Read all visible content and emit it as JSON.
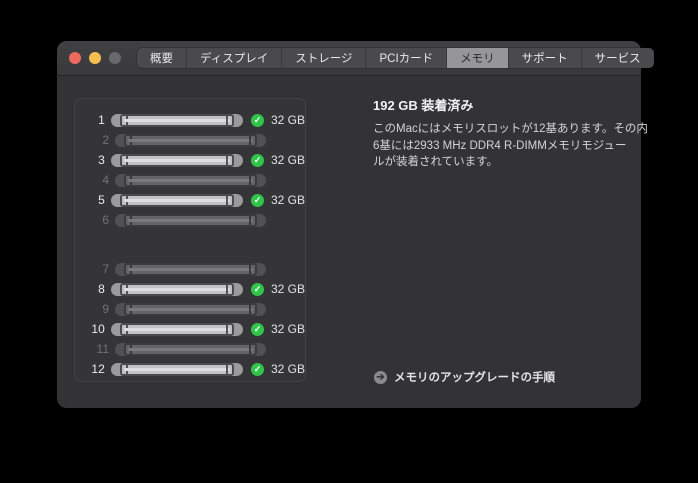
{
  "window": {
    "traffic_lights": {
      "close": "close-button",
      "minimize": "minimize-button",
      "zoom": "zoom-button-disabled"
    },
    "tabs": [
      {
        "label": "概要",
        "selected": false
      },
      {
        "label": "ディスプレイ",
        "selected": false
      },
      {
        "label": "ストレージ",
        "selected": false
      },
      {
        "label": "PCIカード",
        "selected": false
      },
      {
        "label": "メモリ",
        "selected": true
      },
      {
        "label": "サポート",
        "selected": false
      },
      {
        "label": "サービス",
        "selected": false
      }
    ]
  },
  "memory": {
    "summary_title": "192 GB 装着済み",
    "summary_body": "このMacにはメモリスロットが12基あります。その内\n6基には2933 MHz DDR4 R-DIMMメモリモジュー\nルが装着されています。",
    "upgrade_link_label": "メモリのアップグレードの手順",
    "slots": [
      {
        "num": "1",
        "populated": true,
        "size": "32 GB"
      },
      {
        "num": "2",
        "populated": false,
        "size": ""
      },
      {
        "num": "3",
        "populated": true,
        "size": "32 GB"
      },
      {
        "num": "4",
        "populated": false,
        "size": ""
      },
      {
        "num": "5",
        "populated": true,
        "size": "32 GB"
      },
      {
        "num": "6",
        "populated": false,
        "size": ""
      },
      {
        "num": "7",
        "populated": false,
        "size": ""
      },
      {
        "num": "8",
        "populated": true,
        "size": "32 GB"
      },
      {
        "num": "9",
        "populated": false,
        "size": ""
      },
      {
        "num": "10",
        "populated": true,
        "size": "32 GB"
      },
      {
        "num": "11",
        "populated": false,
        "size": ""
      },
      {
        "num": "12",
        "populated": true,
        "size": "32 GB"
      }
    ]
  },
  "icons": {
    "check_icon_glyph": "✓",
    "arrow_icon_glyph": "➔"
  },
  "colors": {
    "status_green": "#30c54a",
    "selected_tab_bg": "#969698",
    "traffic_red": "#ec6a5e",
    "traffic_yellow": "#f4bf4f",
    "window_bg": "#333335",
    "titlebar_bg": "#3d3d3f"
  }
}
